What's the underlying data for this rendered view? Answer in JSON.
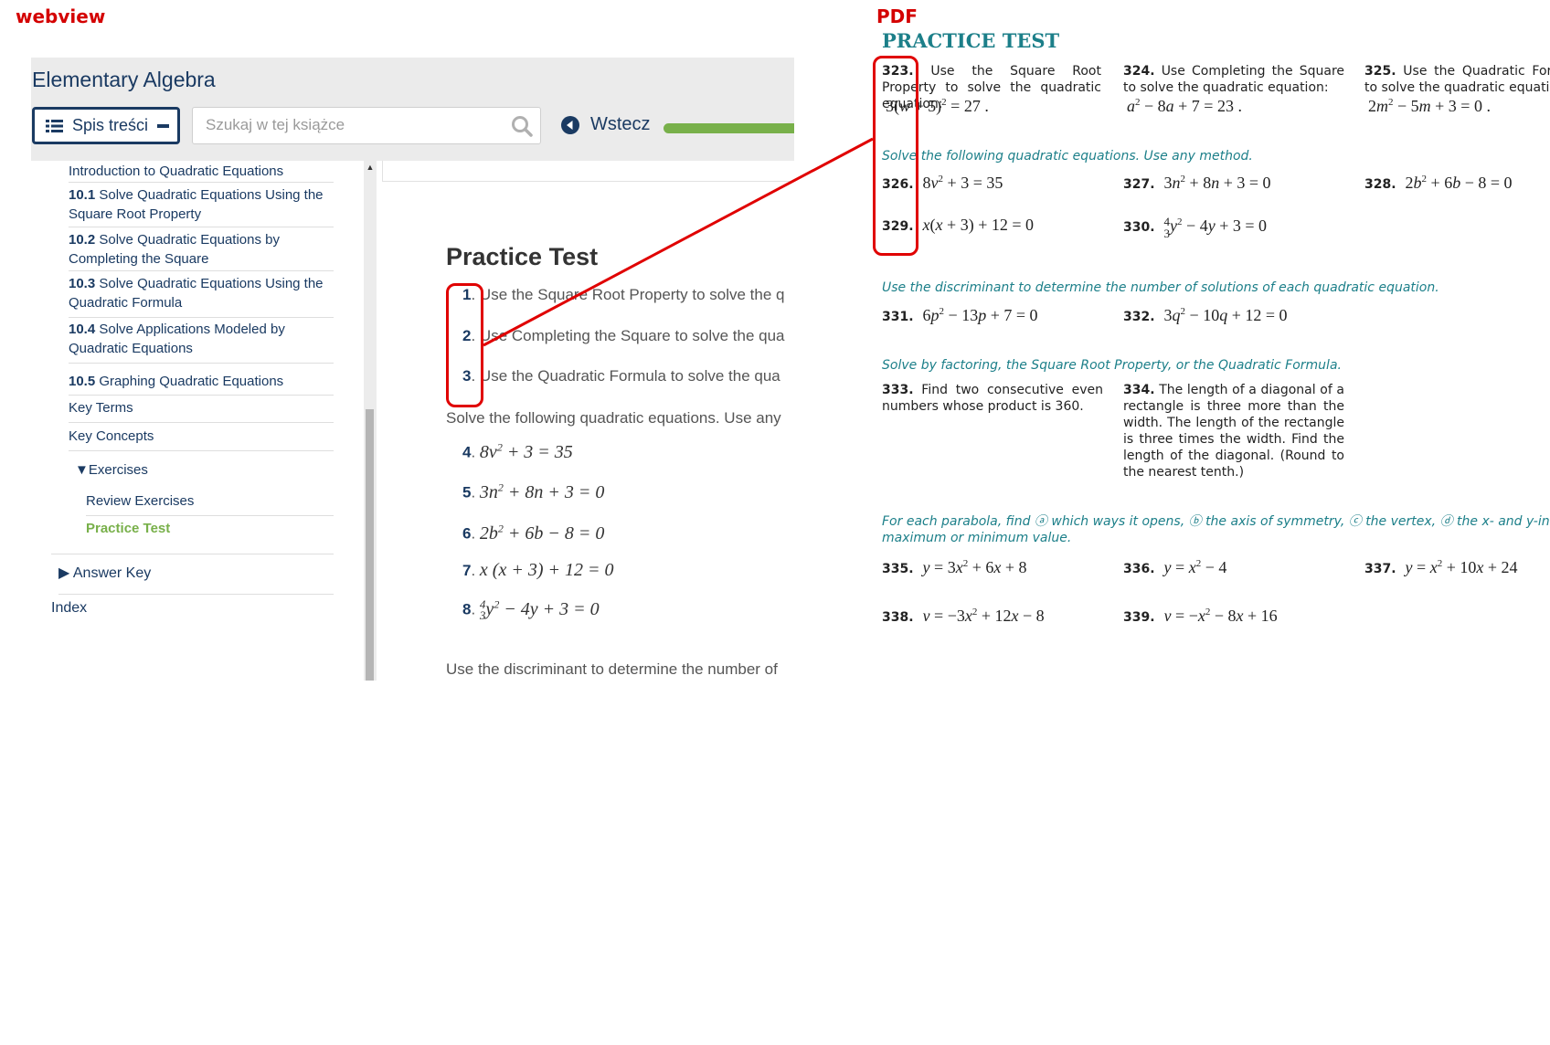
{
  "captions": {
    "webview": "webview",
    "pdf": "PDF"
  },
  "header": {
    "book_title": "Elementary Algebra",
    "toc_button": "Spis treści",
    "search_placeholder": "Szukaj w tej książce",
    "back_label": "Wstecz",
    "progress_fraction": 1.0
  },
  "toc": {
    "intro": "Introduction to Quadratic Equations",
    "items": [
      {
        "num": "10.1",
        "label": "Solve Quadratic Equations Using the",
        "label2": "Square Root Property"
      },
      {
        "num": "10.2",
        "label": "Solve Quadratic Equations by",
        "label2": "Completing the Square"
      },
      {
        "num": "10.3",
        "label": "Solve Quadratic Equations Using the",
        "label2": "Quadratic Formula"
      },
      {
        "num": "10.4",
        "label": "Solve Applications Modeled by",
        "label2": "Quadratic Equations"
      },
      {
        "num": "10.5",
        "label": "Graphing Quadratic Equations",
        "label2": ""
      }
    ],
    "key_terms": "Key Terms",
    "key_concepts": "Key Concepts",
    "exercises": "Exercises",
    "review_exercises": "Review Exercises",
    "practice_test": "Practice Test",
    "answer_key": "Answer Key",
    "index": "Index"
  },
  "main": {
    "title": "Practice Test",
    "problems": [
      {
        "num": "1",
        "text": "Use the Square Root Property to solve the q"
      },
      {
        "num": "2",
        "text": "Use Completing the Square to solve the qua"
      },
      {
        "num": "3",
        "text": "Use the Quadratic Formula to solve the qua"
      }
    ],
    "instruction1": "Solve the following quadratic equations. Use any",
    "equations": [
      {
        "num": "4"
      },
      {
        "num": "5"
      },
      {
        "num": "6"
      },
      {
        "num": "7"
      },
      {
        "num": "8"
      }
    ],
    "instruction2": "Use the discriminant to determine the number of"
  },
  "pdf": {
    "title": "PRACTICE TEST",
    "p323": {
      "num": "323.",
      "text": "Use the Square Root Property to solve the quadratic equation:"
    },
    "p324": {
      "num": "324.",
      "text": "Use Completing the Square to solve the quadratic equation:"
    },
    "p325": {
      "num": "325.",
      "text": "Use the Quadratic Formula to solve the quadratic equation:"
    },
    "instr1": "Solve the following quadratic equations. Use any method.",
    "n326": "326.",
    "n327": "327.",
    "n328": "328.",
    "n329": "329.",
    "n330": "330.",
    "instr2": "Use the discriminant to determine the number of solutions of each quadratic equation.",
    "n331": "331.",
    "n332": "332.",
    "instr3": "Solve by factoring, the Square Root Property, or the Quadratic Formula.",
    "p333": {
      "num": "333.",
      "text": "Find two consecutive even numbers whose product is 360."
    },
    "p334": {
      "num": "334.",
      "text": "The length of a diagonal of a rectangle is three more than the width. The length of the rectangle is three times the width. Find the length of the diagonal. (Round to the nearest tenth.)"
    },
    "instr4a": "For each parabola, find ⓐ which ways it opens, ⓑ the axis of symmetry, ⓒ the vertex, ⓓ the x- and y-interce",
    "instr4b": "maximum or minimum value.",
    "n335": "335.",
    "n336": "336.",
    "n337": "337.",
    "n338": "338.",
    "n339": "339."
  },
  "colors": {
    "annotation": "#e00000",
    "accent_navy": "#1a3a62",
    "accent_green": "#78b04a",
    "pdf_teal": "#1c7f89"
  }
}
